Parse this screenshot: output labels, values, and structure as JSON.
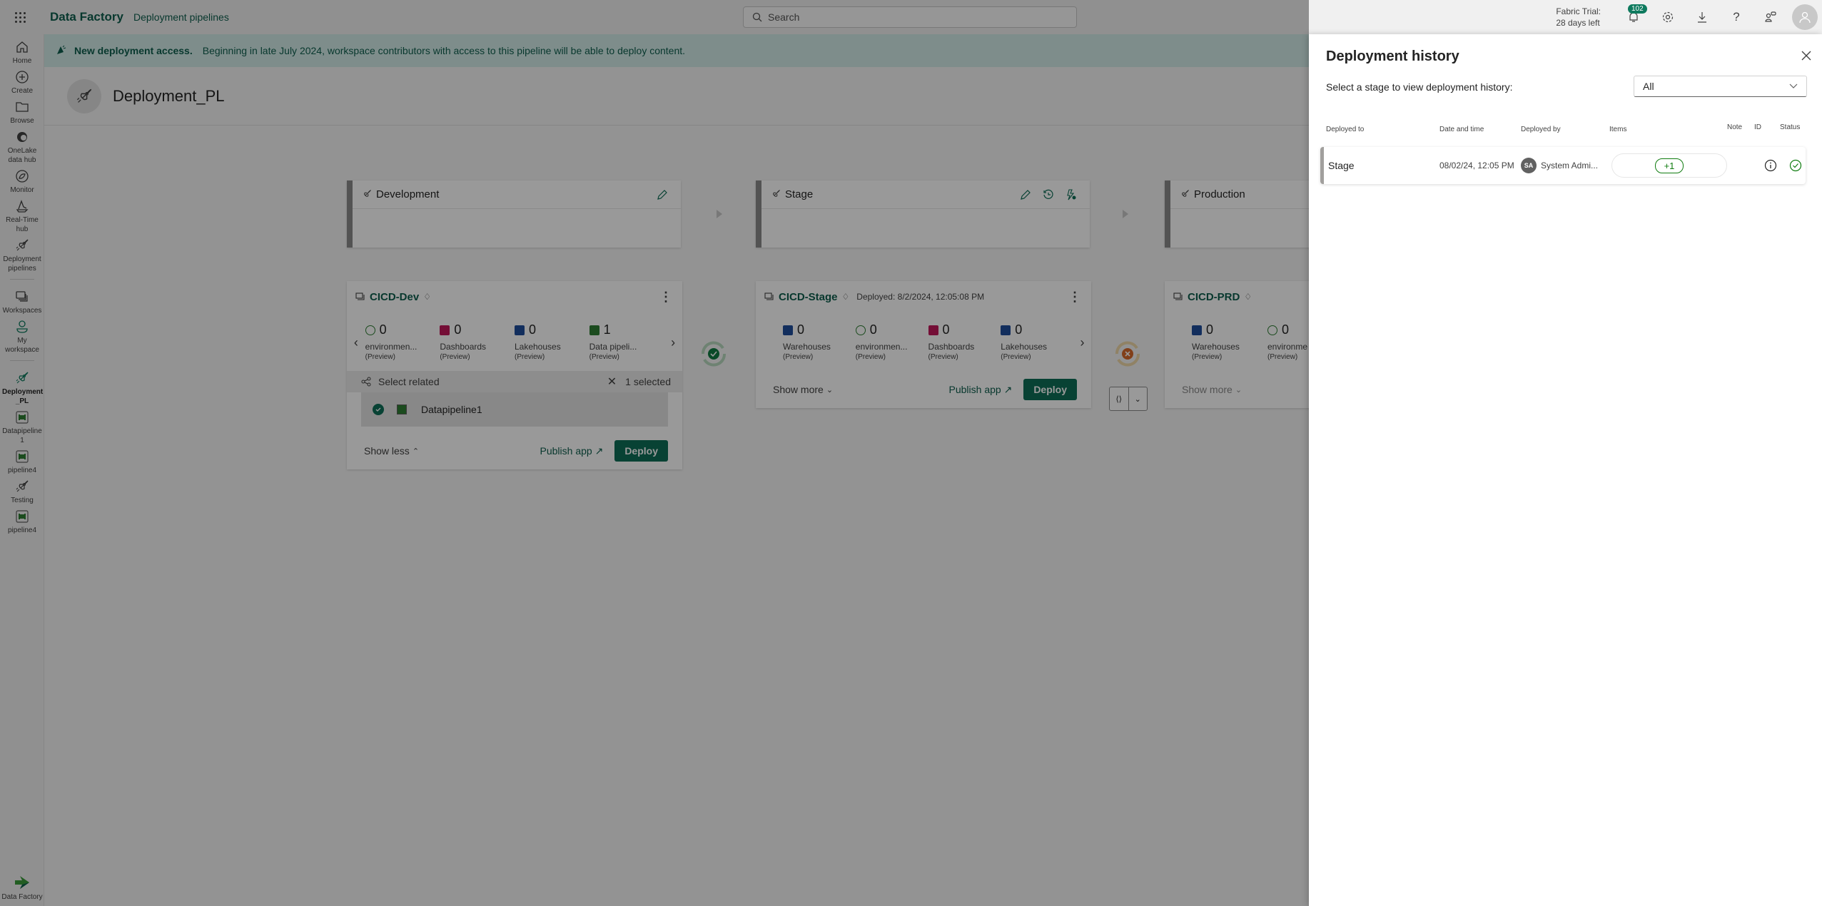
{
  "topbar": {
    "app_name": "Data Factory",
    "section": "Deployment pipelines",
    "search_placeholder": "Search",
    "trial_line1": "Fabric Trial:",
    "trial_line2": "28 days left",
    "notification_count": "102"
  },
  "rail": {
    "items": [
      {
        "label": "Home",
        "icon": "home-icon"
      },
      {
        "label": "Create",
        "icon": "plus-circle-icon"
      },
      {
        "label": "Browse",
        "icon": "folder-icon"
      },
      {
        "label": "OneLake data hub",
        "icon": "onelake-icon"
      },
      {
        "label": "Monitor",
        "icon": "monitor-icon"
      },
      {
        "label": "Real-Time hub",
        "icon": "realtime-icon"
      },
      {
        "label": "Deployment pipelines",
        "icon": "rocket-icon"
      },
      {
        "label": "Workspaces",
        "icon": "workspaces-icon"
      },
      {
        "label": "My workspace",
        "icon": "person-icon"
      },
      {
        "label": "Deployment _PL",
        "icon": "rocket-icon"
      },
      {
        "label": "Datapipeline 1",
        "icon": "pipeline-icon"
      },
      {
        "label": "pipeline4",
        "icon": "pipeline-icon"
      },
      {
        "label": "Testing",
        "icon": "rocket-icon"
      },
      {
        "label": "pipeline4",
        "icon": "pipeline-icon"
      }
    ],
    "bottom_label": "Data Factory"
  },
  "banner": {
    "title": "New deployment access.",
    "text": "Beginning in late July 2024, workspace contributors with access to this pipeline will be able to deploy content."
  },
  "pipeline": {
    "title": "Deployment_PL",
    "stages": [
      {
        "name": "Development"
      },
      {
        "name": "Stage"
      },
      {
        "name": "Production"
      }
    ],
    "workspaces": [
      {
        "name": "CICD-Dev",
        "deployed": "",
        "items": [
          {
            "count": "0",
            "label": "environmen...",
            "sub": "(Preview)",
            "color": "#8a8a8a"
          },
          {
            "count": "0",
            "label": "Dashboards",
            "sub": "(Preview)",
            "color": "#c2185b"
          },
          {
            "count": "0",
            "label": "Lakehouses",
            "sub": "(Preview)",
            "color": "#1f4e9c"
          },
          {
            "count": "1",
            "label": "Data pipeli...",
            "sub": "(Preview)",
            "color": "#2e7d32"
          }
        ],
        "select_related": "Select related",
        "selected_count": "1 selected",
        "selected_item": "Datapipeline1",
        "toggle": "Show less",
        "publish": "Publish app",
        "deploy": "Deploy"
      },
      {
        "name": "CICD-Stage",
        "deployed": "Deployed: 8/2/2024, 12:05:08 PM",
        "items": [
          {
            "count": "0",
            "label": "Warehouses",
            "sub": "(Preview)",
            "color": "#1f4e9c"
          },
          {
            "count": "0",
            "label": "environmen...",
            "sub": "(Preview)",
            "color": "#8a8a8a"
          },
          {
            "count": "0",
            "label": "Dashboards",
            "sub": "(Preview)",
            "color": "#c2185b"
          },
          {
            "count": "0",
            "label": "Lakehouses",
            "sub": "(Preview)",
            "color": "#1f4e9c"
          }
        ],
        "toggle": "Show more",
        "publish": "Publish app",
        "deploy": "Deploy"
      },
      {
        "name": "CICD-PRD",
        "deployed": "",
        "items": [
          {
            "count": "0",
            "label": "Warehouses",
            "sub": "(Preview)",
            "color": "#1f4e9c"
          },
          {
            "count": "0",
            "label": "environme",
            "sub": "(Preview)",
            "color": "#8a8a8a"
          }
        ],
        "toggle": "Show more"
      }
    ],
    "sync_status": [
      "success",
      "failed"
    ]
  },
  "history_panel": {
    "title": "Deployment history",
    "subtitle": "Select a stage to view deployment history:",
    "filter_value": "All",
    "columns": [
      "Deployed to",
      "Date and time",
      "Deployed by",
      "Items",
      "Note",
      "ID",
      "Status"
    ],
    "rows": [
      {
        "deployed_to": "Stage",
        "datetime": "08/02/24, 12:05 PM",
        "initials": "SA",
        "deployed_by": "System Admi...",
        "items": "+1",
        "status": "success"
      }
    ]
  }
}
